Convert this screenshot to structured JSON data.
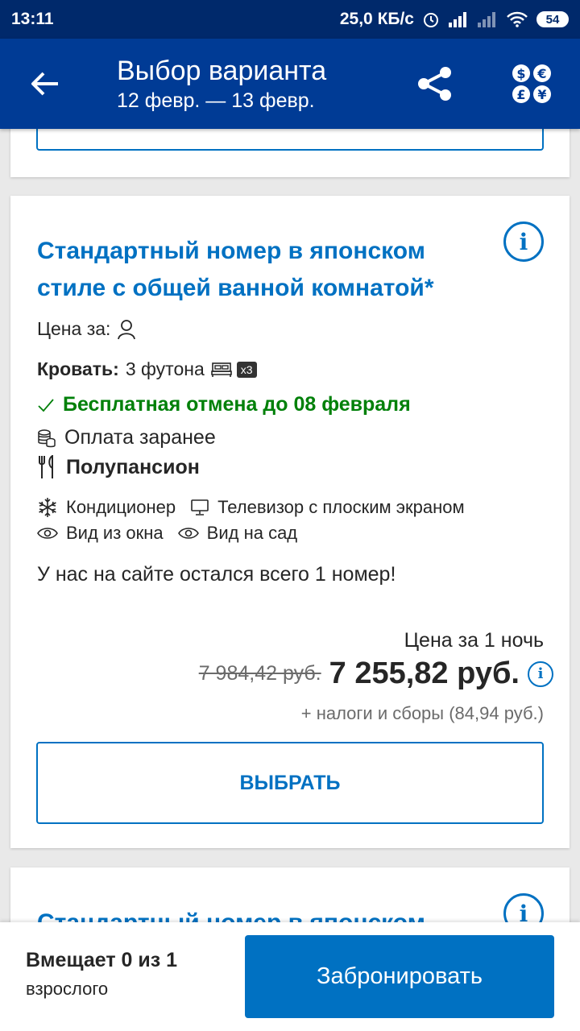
{
  "status_bar": {
    "time": "13:11",
    "speed": "25,0 КБ/с",
    "battery": "54"
  },
  "appbar": {
    "title": "Выбор варианта",
    "dates": "12 февр. — 13 февр."
  },
  "room": {
    "title": "Стандартный номер в японском стиле с общей ванной комнатой*",
    "price_for_label": "Цена за:",
    "bed_label": "Кровать:",
    "bed_value": "3 футона",
    "bed_count": "x3",
    "cancellation": "Бесплатная отмена до 08 февраля",
    "prepayment": "Оплата заранее",
    "meal": "Полупансион",
    "amenities": [
      "Кондиционер",
      "Телевизор с плоским экраном",
      "Вид из окна",
      "Вид на сад"
    ],
    "rooms_left": "У нас на сайте остался всего 1 номер!",
    "price_label": "Цена за 1 ночь",
    "old_price": "7 984,42 руб.",
    "price": "7 255,82 руб.",
    "taxes": "+ налоги и сборы (84,94 руб.)",
    "select_label": "ВЫБРАТЬ"
  },
  "next_room": {
    "title": "Стандартный номер в японском"
  },
  "bottom": {
    "occupancy": "Вмещает 0 из 1",
    "occupancy_unit": "взрослого",
    "book_label": "Забронировать"
  },
  "colors": {
    "statusbar": "#00296b",
    "appbar": "#003b95",
    "accent": "#0071c2",
    "green": "#008009"
  }
}
